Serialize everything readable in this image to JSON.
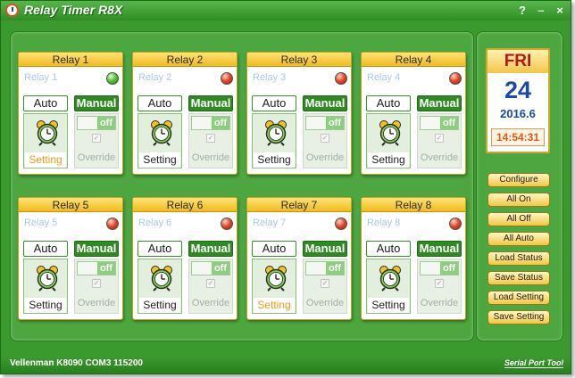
{
  "window": {
    "title": "Relay Timer R8X",
    "help_label": "?",
    "minimize_label": "–",
    "close_label": "×"
  },
  "relays": [
    {
      "header": "Relay 1",
      "name": "Relay 1",
      "status": "on",
      "auto": "Auto",
      "manual": "Manual",
      "toggle": "off",
      "setting": "Setting",
      "setting_active": true,
      "override": "Override"
    },
    {
      "header": "Relay 2",
      "name": "Relay 2",
      "status": "off",
      "auto": "Auto",
      "manual": "Manual",
      "toggle": "off",
      "setting": "Setting",
      "setting_active": false,
      "override": "Override"
    },
    {
      "header": "Relay 3",
      "name": "Relay 3",
      "status": "off",
      "auto": "Auto",
      "manual": "Manual",
      "toggle": "off",
      "setting": "Setting",
      "setting_active": false,
      "override": "Override"
    },
    {
      "header": "Relay 4",
      "name": "Relay 4",
      "status": "off",
      "auto": "Auto",
      "manual": "Manual",
      "toggle": "off",
      "setting": "Setting",
      "setting_active": false,
      "override": "Override"
    },
    {
      "header": "Relay 5",
      "name": "Relay 5",
      "status": "off",
      "auto": "Auto",
      "manual": "Manual",
      "toggle": "off",
      "setting": "Setting",
      "setting_active": false,
      "override": "Override"
    },
    {
      "header": "Relay 6",
      "name": "Relay 6",
      "status": "off",
      "auto": "Auto",
      "manual": "Manual",
      "toggle": "off",
      "setting": "Setting",
      "setting_active": false,
      "override": "Override"
    },
    {
      "header": "Relay 7",
      "name": "Relay 7",
      "status": "off",
      "auto": "Auto",
      "manual": "Manual",
      "toggle": "off",
      "setting": "Setting",
      "setting_active": true,
      "override": "Override"
    },
    {
      "header": "Relay 8",
      "name": "Relay 8",
      "status": "off",
      "auto": "Auto",
      "manual": "Manual",
      "toggle": "off",
      "setting": "Setting",
      "setting_active": false,
      "override": "Override"
    }
  ],
  "calendar": {
    "day": "FRI",
    "date": "24",
    "year_month": "2016.6",
    "time": "14:54:31"
  },
  "side_buttons": [
    "Configure",
    "All On",
    "All Off",
    "All Auto",
    "Load Status",
    "Save Status",
    "Load Setting",
    "Save Setting"
  ],
  "status_bar": {
    "text": "Vellenman K8090 COM3 115200",
    "serial_tool": "Serial Port Tool"
  },
  "colors": {
    "led_on": "#5cc23e",
    "led_off": "#e84a2c",
    "setting_active": "#f09a10",
    "frame_green": "#3a9a2e"
  }
}
